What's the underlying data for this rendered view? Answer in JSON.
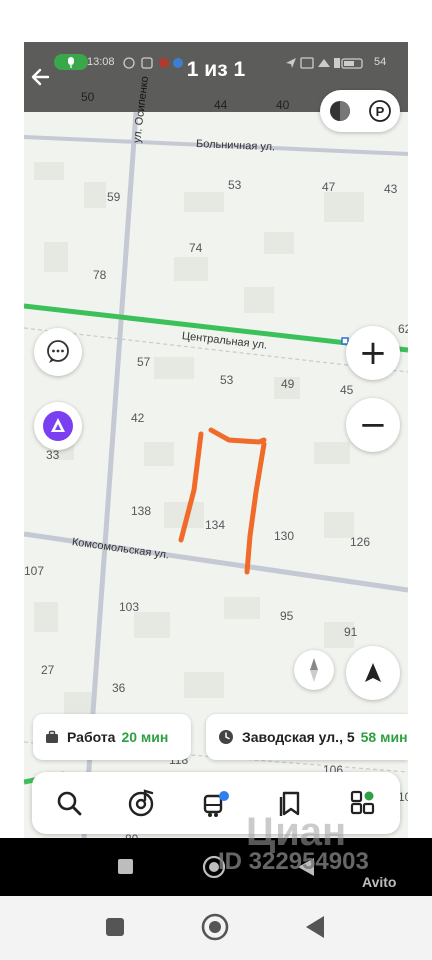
{
  "status_bar": {
    "time": "13:08",
    "battery": "54"
  },
  "header": {
    "back_label": "←",
    "photo_counter": "1 из 1"
  },
  "map": {
    "streets": {
      "osipenko": "ул. Осипенко",
      "bolnichnaya": "Больничная ул.",
      "centralnaya": "Центральная ул.",
      "komsomolskaya": "Комсомольская ул."
    },
    "house_numbers": [
      "50",
      "44",
      "40",
      "53",
      "47",
      "43",
      "59",
      "74",
      "78",
      "62",
      "57",
      "53",
      "49",
      "45",
      "42",
      "33",
      "138",
      "134",
      "130",
      "126",
      "107",
      "103",
      "95",
      "91",
      "27",
      "36",
      "118",
      "106",
      "80",
      "10"
    ]
  },
  "controls": {
    "zoom_in_label": "+",
    "zoom_out_label": "−",
    "parking_label": "P"
  },
  "routes": [
    {
      "label": "Работа",
      "time": "20 мин",
      "icon": "briefcase-icon"
    },
    {
      "label": "Заводская ул., 5",
      "time": "58 мин",
      "icon": "clock-icon"
    }
  ],
  "tabbar": [
    {
      "name": "search",
      "icon": "search-icon"
    },
    {
      "name": "music",
      "icon": "music-icon"
    },
    {
      "name": "transport",
      "icon": "transport-icon"
    },
    {
      "name": "bookmarks",
      "icon": "bookmark-icon"
    },
    {
      "name": "services",
      "icon": "services-icon"
    }
  ],
  "watermark": {
    "cian": "Циан",
    "id_text": "ID 322954903",
    "avito": "Avito"
  },
  "colors": {
    "route_time": "#2ea043",
    "road_green": "#3cc15a",
    "annotation": "#f06a2a",
    "alice": "#7b3ff2"
  }
}
